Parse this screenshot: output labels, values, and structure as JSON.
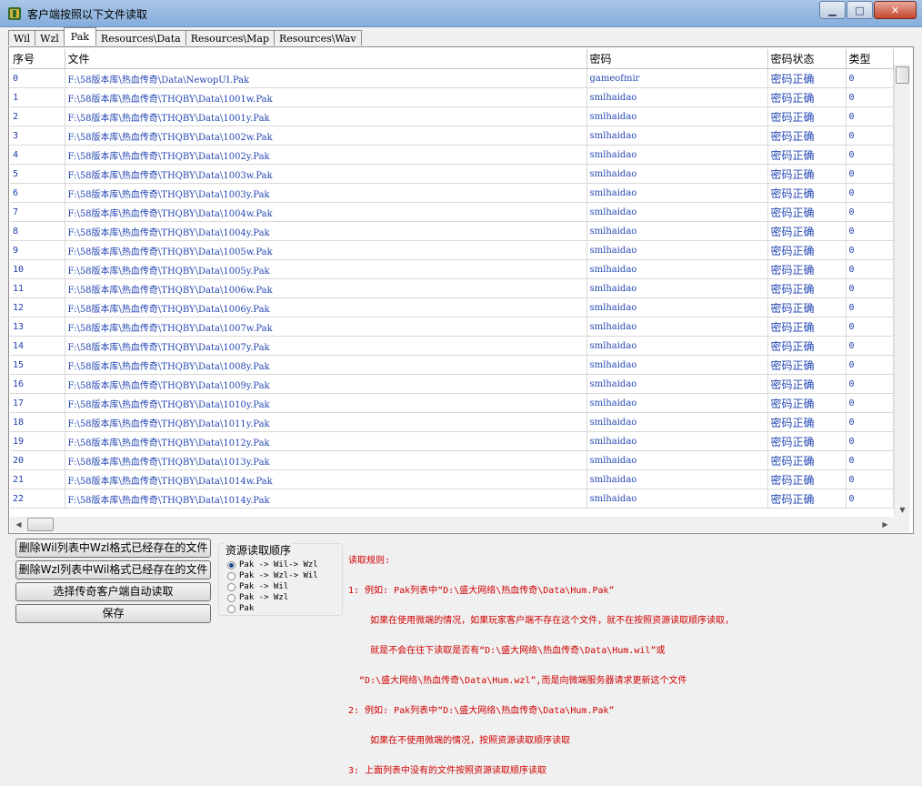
{
  "window": {
    "title": "客户端按照以下文件读取",
    "controls": {
      "minimize": "▁",
      "maximize": "□",
      "close": "✕"
    }
  },
  "tabs": [
    "Wil",
    "Wzl",
    "Pak",
    "Resources\\Data",
    "Resources\\Map",
    "Resources\\Wav"
  ],
  "active_tab": "Pak",
  "columns": [
    "序号",
    "文件",
    "密码",
    "密码状态",
    "类型"
  ],
  "rows": [
    [
      "0",
      "F:\\58版本库\\热血传奇\\Data\\NewopUI.Pak",
      "gameofmir",
      "密码正确",
      "0"
    ],
    [
      "1",
      "F:\\58版本库\\热血传奇\\THQBY\\Data\\1001w.Pak",
      "smlhaidao",
      "密码正确",
      "0"
    ],
    [
      "2",
      "F:\\58版本库\\热血传奇\\THQBY\\Data\\1001y.Pak",
      "smlhaidao",
      "密码正确",
      "0"
    ],
    [
      "3",
      "F:\\58版本库\\热血传奇\\THQBY\\Data\\1002w.Pak",
      "smlhaidao",
      "密码正确",
      "0"
    ],
    [
      "4",
      "F:\\58版本库\\热血传奇\\THQBY\\Data\\1002y.Pak",
      "smlhaidao",
      "密码正确",
      "0"
    ],
    [
      "5",
      "F:\\58版本库\\热血传奇\\THQBY\\Data\\1003w.Pak",
      "smlhaidao",
      "密码正确",
      "0"
    ],
    [
      "6",
      "F:\\58版本库\\热血传奇\\THQBY\\Data\\1003y.Pak",
      "smlhaidao",
      "密码正确",
      "0"
    ],
    [
      "7",
      "F:\\58版本库\\热血传奇\\THQBY\\Data\\1004w.Pak",
      "smlhaidao",
      "密码正确",
      "0"
    ],
    [
      "8",
      "F:\\58版本库\\热血传奇\\THQBY\\Data\\1004y.Pak",
      "smlhaidao",
      "密码正确",
      "0"
    ],
    [
      "9",
      "F:\\58版本库\\热血传奇\\THQBY\\Data\\1005w.Pak",
      "smlhaidao",
      "密码正确",
      "0"
    ],
    [
      "10",
      "F:\\58版本库\\热血传奇\\THQBY\\Data\\1005y.Pak",
      "smlhaidao",
      "密码正确",
      "0"
    ],
    [
      "11",
      "F:\\58版本库\\热血传奇\\THQBY\\Data\\1006w.Pak",
      "smlhaidao",
      "密码正确",
      "0"
    ],
    [
      "12",
      "F:\\58版本库\\热血传奇\\THQBY\\Data\\1006y.Pak",
      "smlhaidao",
      "密码正确",
      "0"
    ],
    [
      "13",
      "F:\\58版本库\\热血传奇\\THQBY\\Data\\1007w.Pak",
      "smlhaidao",
      "密码正确",
      "0"
    ],
    [
      "14",
      "F:\\58版本库\\热血传奇\\THQBY\\Data\\1007y.Pak",
      "smlhaidao",
      "密码正确",
      "0"
    ],
    [
      "15",
      "F:\\58版本库\\热血传奇\\THQBY\\Data\\1008y.Pak",
      "smlhaidao",
      "密码正确",
      "0"
    ],
    [
      "16",
      "F:\\58版本库\\热血传奇\\THQBY\\Data\\1009y.Pak",
      "smlhaidao",
      "密码正确",
      "0"
    ],
    [
      "17",
      "F:\\58版本库\\热血传奇\\THQBY\\Data\\1010y.Pak",
      "smlhaidao",
      "密码正确",
      "0"
    ],
    [
      "18",
      "F:\\58版本库\\热血传奇\\THQBY\\Data\\1011y.Pak",
      "smlhaidao",
      "密码正确",
      "0"
    ],
    [
      "19",
      "F:\\58版本库\\热血传奇\\THQBY\\Data\\1012y.Pak",
      "smlhaidao",
      "密码正确",
      "0"
    ],
    [
      "20",
      "F:\\58版本库\\热血传奇\\THQBY\\Data\\1013y.Pak",
      "smlhaidao",
      "密码正确",
      "0"
    ],
    [
      "21",
      "F:\\58版本库\\热血传奇\\THQBY\\Data\\1014w.Pak",
      "smlhaidao",
      "密码正确",
      "0"
    ],
    [
      "22",
      "F:\\58版本库\\热血传奇\\THQBY\\Data\\1014y.Pak",
      "smlhaidao",
      "密码正确",
      "0"
    ]
  ],
  "buttons": {
    "delete_wil": "删除Wil列表中Wzl格式已经存在的文件",
    "delete_wzl": "删除Wzl列表中Wil格式已经存在的文件",
    "auto_read": "选择传奇客户端自动读取",
    "save": "保存"
  },
  "read_order": {
    "legend": "资源读取顺序",
    "options": [
      "Pak -> Wil-> Wzl",
      "Pak -> Wzl-> Wil",
      "Pak -> Wil",
      "Pak -> Wzl",
      "Pak"
    ],
    "selected": 0
  },
  "rules": [
    "读取规则:",
    "1: 例如: Pak列表中“D:\\盛大网络\\热血传奇\\Data\\Hum.Pak”",
    "    如果在使用微端的情况，如果玩家客户端不存在这个文件，就不在按照资源读取顺序读取，",
    "    就是不会在往下读取是否有“D:\\盛大网络\\热血传奇\\Data\\Hum.wil”或",
    "  “D:\\盛大网络\\热血传奇\\Data\\Hum.wzl”,而是向微端服务器请求更新这个文件",
    "2: 例如: Pak列表中“D:\\盛大网络\\热血传奇\\Data\\Hum.Pak”",
    "    如果在不使用微端的情况，按照资源读取顺序读取",
    "3: 上面列表中没有的文件按照资源读取顺序读取"
  ]
}
